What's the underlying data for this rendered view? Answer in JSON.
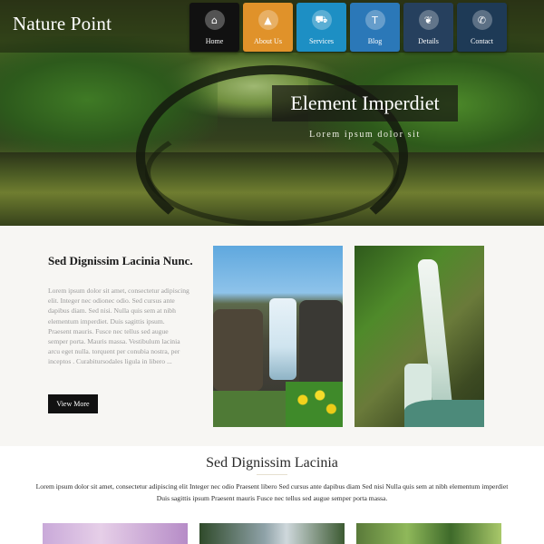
{
  "header": {
    "logo": "Nature Point"
  },
  "nav": {
    "items": [
      {
        "label": "Home",
        "icon": "home-icon",
        "glyph": "⌂",
        "color": "#111111"
      },
      {
        "label": "About Us",
        "icon": "mountain-icon",
        "glyph": "▲",
        "color": "#e0922a"
      },
      {
        "label": "Services",
        "icon": "car-icon",
        "glyph": "⛟",
        "color": "#1d8fc4"
      },
      {
        "label": "Blog",
        "icon": "text-icon",
        "glyph": "T",
        "color": "#2b78b8"
      },
      {
        "label": "Details",
        "icon": "leaf-icon",
        "glyph": "❦",
        "color": "#26405e"
      },
      {
        "label": "Contact",
        "icon": "phone-icon",
        "glyph": "✆",
        "color": "#1e3a56"
      }
    ]
  },
  "hero": {
    "banner_title": "Element Imperdiet",
    "banner_subtitle": "Lorem ipsum dolor sit"
  },
  "about": {
    "title": "Sed Dignissim Lacinia Nunc.",
    "text": "Lorem ipsum dolor sit amet, consectetur adipiscing elit. Integer nec odionec odio. Sed cursus ante dapibus diam. Sed nisi. Nulla quis sem at nibh elementum imperdiet. Duis sagittis ipsum. Praesent mauris. Fusce nec tellus sed augue semper porta. Mauris massa. Vestibulum lacinia arcu eget nulla. torquent per conubia nostra, per inceptos . Curabitursodales ligula in libero ...",
    "button_label": "View More"
  },
  "section2": {
    "title": "Sed Dignissim Lacinia",
    "text": "Lorem ipsum dolor sit amet, consectetur adipiscing elit Integer nec odio Praesent libero Sed cursus ante dapibus diam Sed nisi Nulla quis sem at nibh elementum imperdiet Duis sagittis ipsum Praesent mauris Fusce nec tellus sed augue semper porta massa."
  }
}
